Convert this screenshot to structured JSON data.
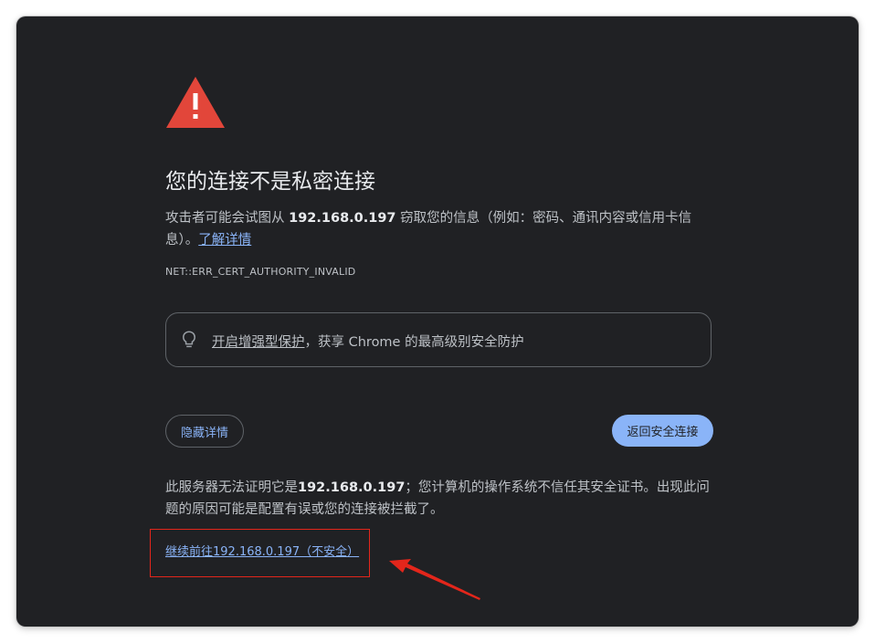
{
  "page": {
    "title": "您的连接不是私密连接",
    "description": {
      "prefix": "攻击者可能会试图从 ",
      "host": "192.168.0.197",
      "suffix": " 窃取您的信息（例如：密码、通讯内容或信用卡信息）。",
      "learn_more": "了解详情"
    },
    "error_code": "NET::ERR_CERT_AUTHORITY_INVALID",
    "enhanced_protection": {
      "link": "开启增强型保护",
      "text": "，获享 Chrome 的最高级别安全防护"
    },
    "buttons": {
      "hide_details": "隐藏详情",
      "back_to_safety": "返回安全连接"
    },
    "details": {
      "prefix": "此服务器无法证明它是",
      "host": "192.168.0.197",
      "suffix": "；您计算机的操作系统不信任其安全证书。出现此问题的原因可能是配置有误或您的连接被拦截了。"
    },
    "proceed_link": "继续前往192.168.0.197（不安全）"
  },
  "icons": {
    "warning": "warning-triangle-icon",
    "bulb": "lightbulb-icon"
  },
  "colors": {
    "background": "#202124",
    "warning_red": "#e2463a",
    "link_blue": "#8ab4f8",
    "annotation_red": "#e3261b"
  }
}
